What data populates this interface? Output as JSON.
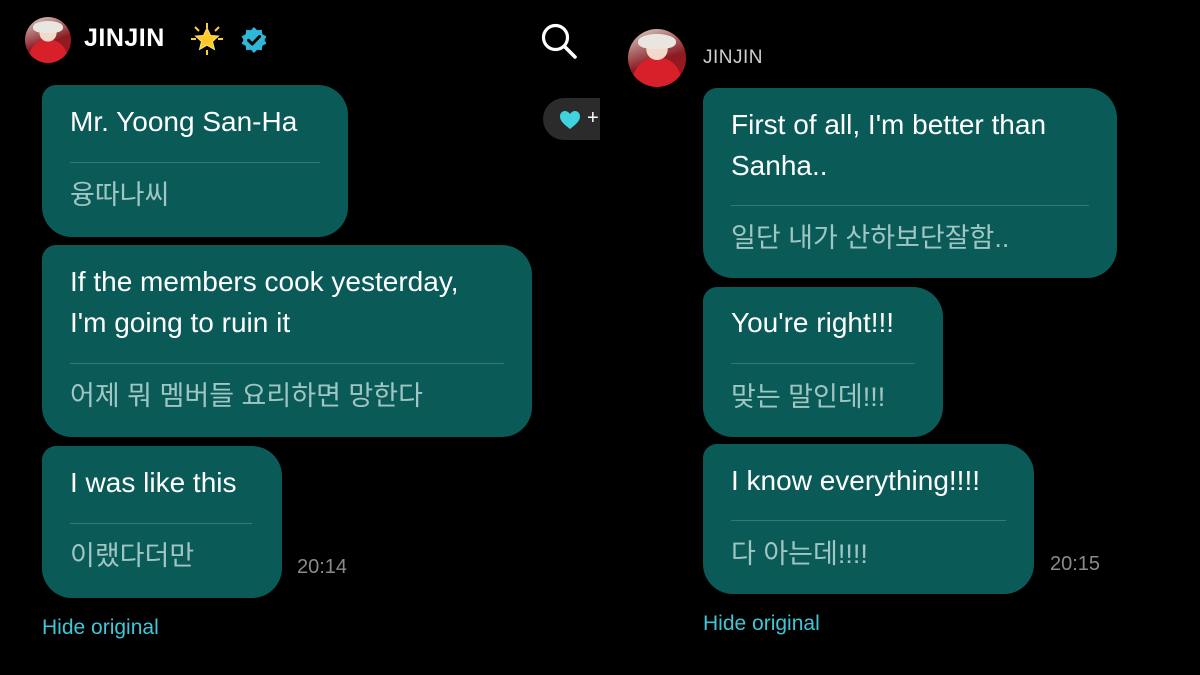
{
  "left": {
    "username": "JINJIN",
    "messages": [
      {
        "en": "Mr. Yoong San-Ha",
        "ko": "융따나씨"
      },
      {
        "en_line1": "If the members cook yesterday,",
        "en_line2": "I'm going to ruin it",
        "ko": "어제 뭐 멤버들 요리하면 망한다"
      },
      {
        "en": "I was like this",
        "ko": "이랬다더만"
      }
    ],
    "time": "20:14",
    "hide_original": "Hide original",
    "reaction_plus": "+"
  },
  "right": {
    "username": "JINJIN",
    "messages": [
      {
        "en_line1": "First of all, I'm better than",
        "en_line2": "Sanha..",
        "ko": "일단 내가 산하보단잘함.."
      },
      {
        "en": "You're right!!!",
        "ko": "맞는 말인데!!!"
      },
      {
        "en": "I know everything!!!!",
        "ko": "다 아는데!!!!"
      }
    ],
    "time": "20:15",
    "hide_original": "Hide original"
  },
  "colors": {
    "bubble": "#0a5a58",
    "link": "#3ec7d6",
    "verified": "#2fb7d8",
    "heart": "#3fd3e0"
  },
  "icons": [
    "star-icon",
    "verified-badge-icon",
    "search-icon",
    "heart-icon"
  ]
}
